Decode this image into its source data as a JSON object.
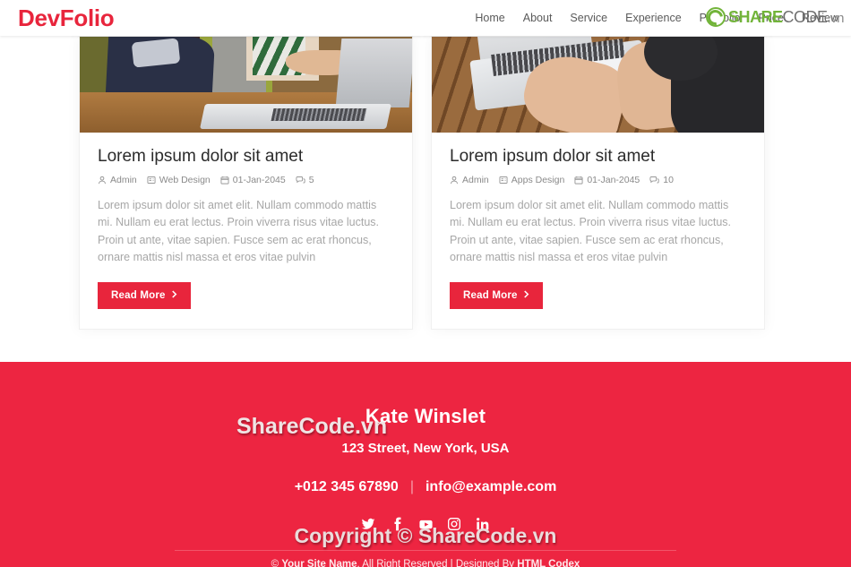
{
  "header": {
    "brand": "DevFolio",
    "nav": [
      {
        "label": "Home"
      },
      {
        "label": "About"
      },
      {
        "label": "Service"
      },
      {
        "label": "Experience"
      },
      {
        "label": "Portfolio"
      },
      {
        "label": "Price"
      },
      {
        "label": "Review"
      }
    ]
  },
  "watermark": {
    "logo_share": "SHARE",
    "logo_code": "CODE",
    "logo_vn": ".vn",
    "footer_brand": "ShareCode.vn",
    "footer_copyright": "Copyright © ShareCode.vn"
  },
  "cards": [
    {
      "title": "Lorem ipsum dolor sit amet",
      "author": "Admin",
      "category": "Web Design",
      "date": "01-Jan-2045",
      "comments": "5",
      "excerpt": "Lorem ipsum dolor sit amet elit. Nullam commodo mattis mi. Nullam eu erat lectus. Proin viverra risus vitae luctus. Proin ut ante, vitae sapien. Fusce sem ac erat rhoncus, ornare mattis nisl massa et eros vitae pulvin",
      "button": "Read More"
    },
    {
      "title": "Lorem ipsum dolor sit amet",
      "author": "Admin",
      "category": "Apps Design",
      "date": "01-Jan-2045",
      "comments": "10",
      "excerpt": "Lorem ipsum dolor sit amet elit. Nullam commodo mattis mi. Nullam eu erat lectus. Proin viverra risus vitae luctus. Proin ut ante, vitae sapien. Fusce sem ac erat rhoncus, ornare mattis nisl massa et eros vitae pulvin",
      "button": "Read More"
    }
  ],
  "footer": {
    "name": "Kate Winslet",
    "address": "123 Street, New York, USA",
    "phone": "+012 345 67890",
    "separator": "|",
    "email": "info@example.com",
    "social": [
      "twitter",
      "facebook",
      "youtube",
      "instagram",
      "linkedin"
    ],
    "copyright_prefix": "© ",
    "copyright_site": "Your Site Name",
    "copyright_mid": ", All Right Reserved | Designed By ",
    "copyright_author": "HTML Codex"
  },
  "colors": {
    "brand_red": "#E8253C",
    "footer_red": "#ED2541",
    "nav_text": "#5a5a5a",
    "watermark_green": "#72B43A"
  }
}
